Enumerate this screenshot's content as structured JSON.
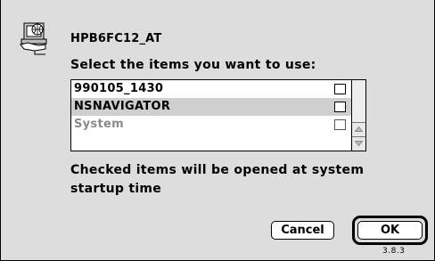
{
  "dialog": {
    "server_name": "HPB6FC12_AT",
    "prompt": "Select the items you want to use:",
    "message": "Checked items will be opened at system startup time",
    "version": "3.8.3"
  },
  "list": {
    "items": [
      {
        "label": "990105_1430",
        "checked": false,
        "selected": false,
        "disabled": false
      },
      {
        "label": "NSNAVIGATOR",
        "checked": false,
        "selected": true,
        "disabled": false
      },
      {
        "label": "System",
        "checked": false,
        "selected": false,
        "disabled": true
      }
    ]
  },
  "buttons": {
    "cancel_label": "Cancel",
    "ok_label": "OK"
  },
  "icons": {
    "app": "file-server-icon",
    "scroll_up": "scroll-up-arrow-icon",
    "scroll_down": "scroll-down-arrow-icon"
  }
}
